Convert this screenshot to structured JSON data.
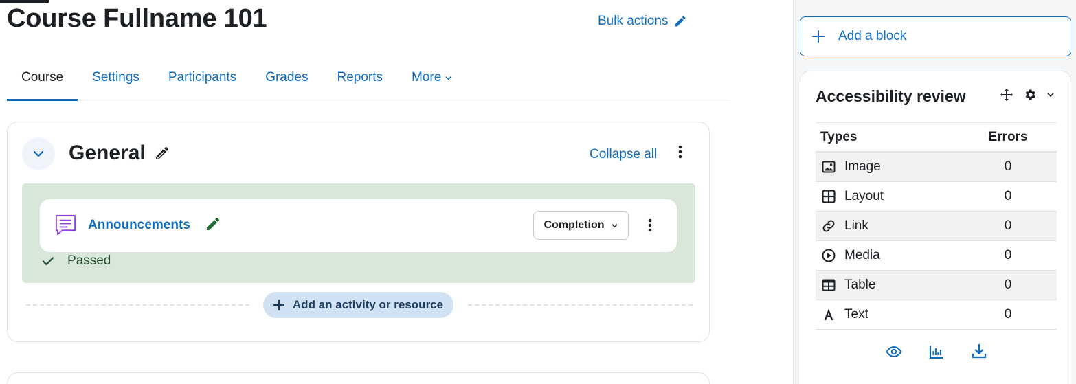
{
  "page": {
    "title": "Course Fullname 101",
    "bulk_actions_label": "Bulk actions"
  },
  "tabs": [
    {
      "label": "Course",
      "active": true
    },
    {
      "label": "Settings"
    },
    {
      "label": "Participants"
    },
    {
      "label": "Grades"
    },
    {
      "label": "Reports"
    },
    {
      "label": "More"
    }
  ],
  "section": {
    "title": "General",
    "collapse_all_label": "Collapse all",
    "activity": {
      "name": "Announcements",
      "completion_label": "Completion",
      "status": "Passed"
    },
    "add_activity_label": "Add an activity or resource"
  },
  "drawer": {
    "add_block_label": "Add a block",
    "accessibility": {
      "title": "Accessibility review",
      "headers": {
        "types": "Types",
        "errors": "Errors"
      },
      "rows": [
        {
          "type": "Image",
          "errors": "0",
          "icon": "image-icon"
        },
        {
          "type": "Layout",
          "errors": "0",
          "icon": "layout-icon"
        },
        {
          "type": "Link",
          "errors": "0",
          "icon": "link-icon"
        },
        {
          "type": "Media",
          "errors": "0",
          "icon": "media-icon"
        },
        {
          "type": "Table",
          "errors": "0",
          "icon": "table-icon"
        },
        {
          "type": "Text",
          "errors": "0",
          "icon": "text-icon"
        }
      ]
    }
  },
  "colors": {
    "link": "#0f6cbf",
    "completion_bg": "#d9e7da",
    "add_activity_bg": "#cfe1f2",
    "activity_icon": "#8f47d9"
  }
}
